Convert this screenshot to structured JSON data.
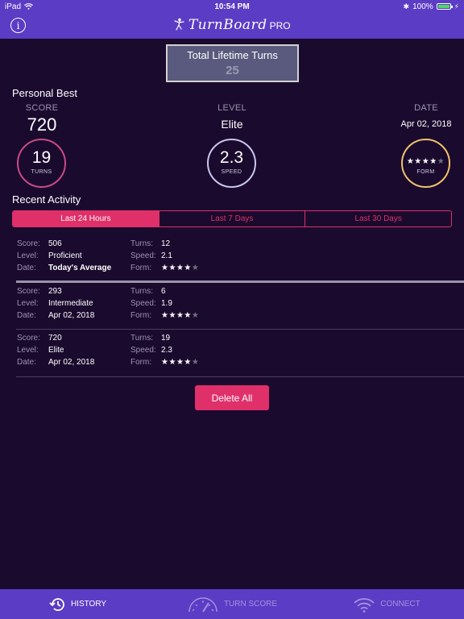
{
  "status_bar": {
    "carrier": "iPad",
    "time": "10:54 PM",
    "battery": "100%",
    "battery_level": 1.0
  },
  "nav": {
    "brand": "TurnBoard",
    "brand_suffix": "PRO",
    "info_glyph": "i"
  },
  "lifetime": {
    "label": "Total Lifetime Turns",
    "value": "25"
  },
  "personal_best": {
    "title": "Personal Best",
    "score_label": "SCORE",
    "score": "720",
    "level_label": "LEVEL",
    "level": "Elite",
    "date_label": "DATE",
    "date": "Apr 02, 2018",
    "turns_value": "19",
    "turns_label": "TURNS",
    "speed_value": "2.3",
    "speed_label": "SPEED",
    "form_label": "FORM",
    "form_stars": 4,
    "form_max": 5
  },
  "recent": {
    "title": "Recent Activity",
    "tabs": [
      "Last 24 Hours",
      "Last 7 Days",
      "Last 30 Days"
    ],
    "active_tab": 0,
    "field_labels": {
      "score": "Score:",
      "level": "Level:",
      "date": "Date:",
      "turns": "Turns:",
      "speed": "Speed:",
      "form": "Form:"
    },
    "rows": [
      {
        "score": "506",
        "level": "Proficient",
        "date": "Today's Average",
        "turns": "12",
        "speed": "2.1",
        "form_stars": 4
      },
      {
        "score": "293",
        "level": "Intermediate",
        "date": "Apr 02, 2018",
        "turns": "6",
        "speed": "1.9",
        "form_stars": 4
      },
      {
        "score": "720",
        "level": "Elite",
        "date": "Apr 02, 2018",
        "turns": "19",
        "speed": "2.3",
        "form_stars": 4
      }
    ]
  },
  "delete_label": "Delete All",
  "tab_bar": [
    {
      "label": "HISTORY",
      "icon": "history-icon",
      "active": true
    },
    {
      "label": "TURN SCORE",
      "icon": "gauge-icon",
      "active": false
    },
    {
      "label": "CONNECT",
      "icon": "wifi-icon",
      "active": false
    }
  ],
  "colors": {
    "background": "#1a0a2e",
    "bar": "#5b3cc4",
    "accent": "#e0306a",
    "turns_ring": "#c74b86",
    "speed_ring": "#c9c6ee",
    "form_ring": "#f1c26a",
    "star": "#f4e33a"
  }
}
